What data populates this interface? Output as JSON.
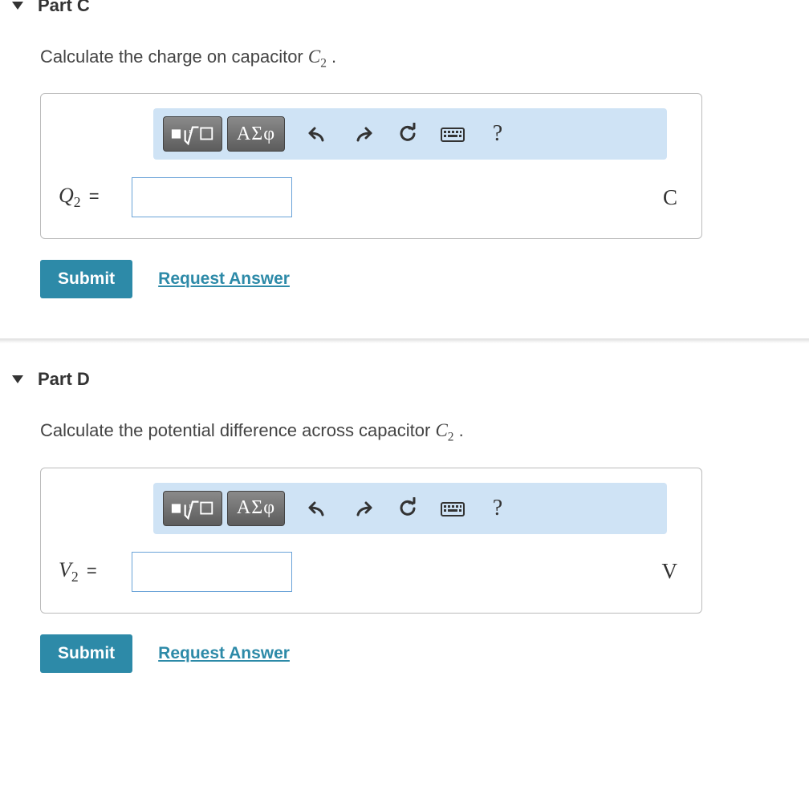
{
  "parts": {
    "c": {
      "title": "Part C",
      "prompt_prefix": "Calculate the charge on capacitor ",
      "prompt_var": "C",
      "prompt_sub": "2",
      "prompt_suffix": " .",
      "var": "Q",
      "var_sub": "2",
      "eq": " =",
      "unit": "C",
      "submit": "Submit",
      "request": "Request Answer"
    },
    "d": {
      "title": "Part D",
      "prompt_prefix": "Calculate the potential difference across capacitor ",
      "prompt_var": "C",
      "prompt_sub": "2",
      "prompt_suffix": " .",
      "var": "V",
      "var_sub": "2",
      "eq": " =",
      "unit": "V",
      "submit": "Submit",
      "request": "Request Answer"
    }
  },
  "toolbar": {
    "greek": "ΑΣφ",
    "help": "?"
  }
}
